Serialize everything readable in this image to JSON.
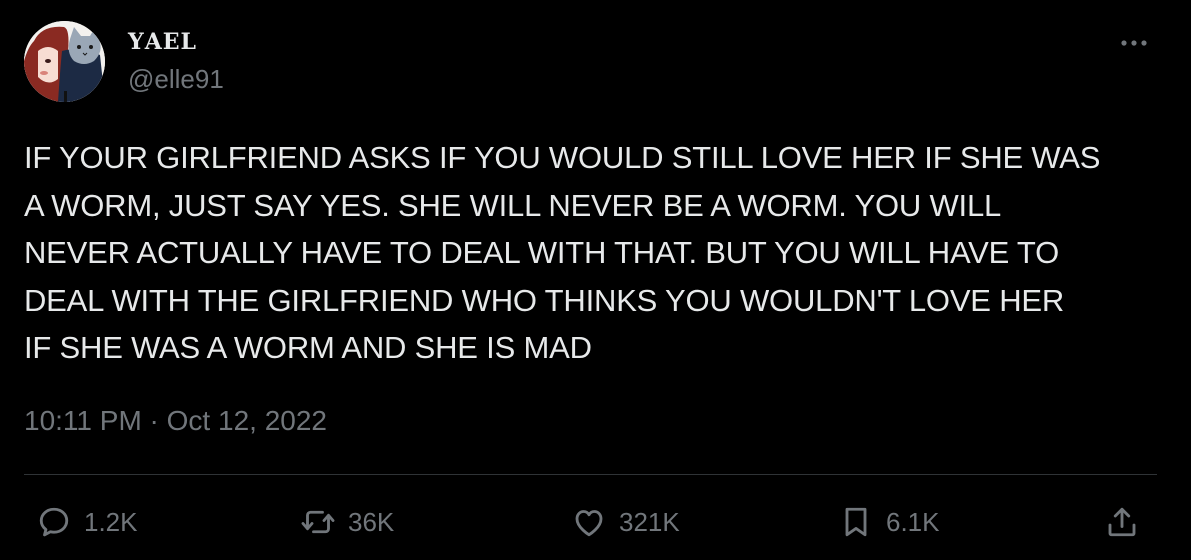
{
  "user": {
    "name_first": "Y",
    "name_rest": "AEL",
    "handle": "@elle91"
  },
  "tweet": {
    "lines": [
      "IF YOUR GIRLFRIEND ASKS IF YOU WOULD STILL LOVE HER IF SHE WAS",
      "A WORM, JUST SAY YES. SHE WILL NEVER BE A WORM. YOU WILL",
      "NEVER ACTUALLY HAVE TO DEAL WITH THAT. BUT YOU WILL HAVE TO",
      "DEAL WITH THE GIRLFRIEND WHO THINKS YOU WOULDN'T LOVE HER",
      "IF SHE WAS A WORM AND SHE IS MAD"
    ],
    "timestamp": "10:11 PM · Oct 12, 2022"
  },
  "actions": {
    "replies": "1.2K",
    "retweets": "36K",
    "likes": "321K",
    "bookmarks": "6.1K"
  },
  "icons": {
    "more": "more-horizontal-icon",
    "reply": "reply-icon",
    "retweet": "retweet-icon",
    "like": "heart-icon",
    "bookmark": "bookmark-icon",
    "share": "share-icon"
  },
  "colors": {
    "background": "#000000",
    "primary_text": "#e7e9ea",
    "secondary_text": "#71767b",
    "divider": "#2f3336"
  }
}
